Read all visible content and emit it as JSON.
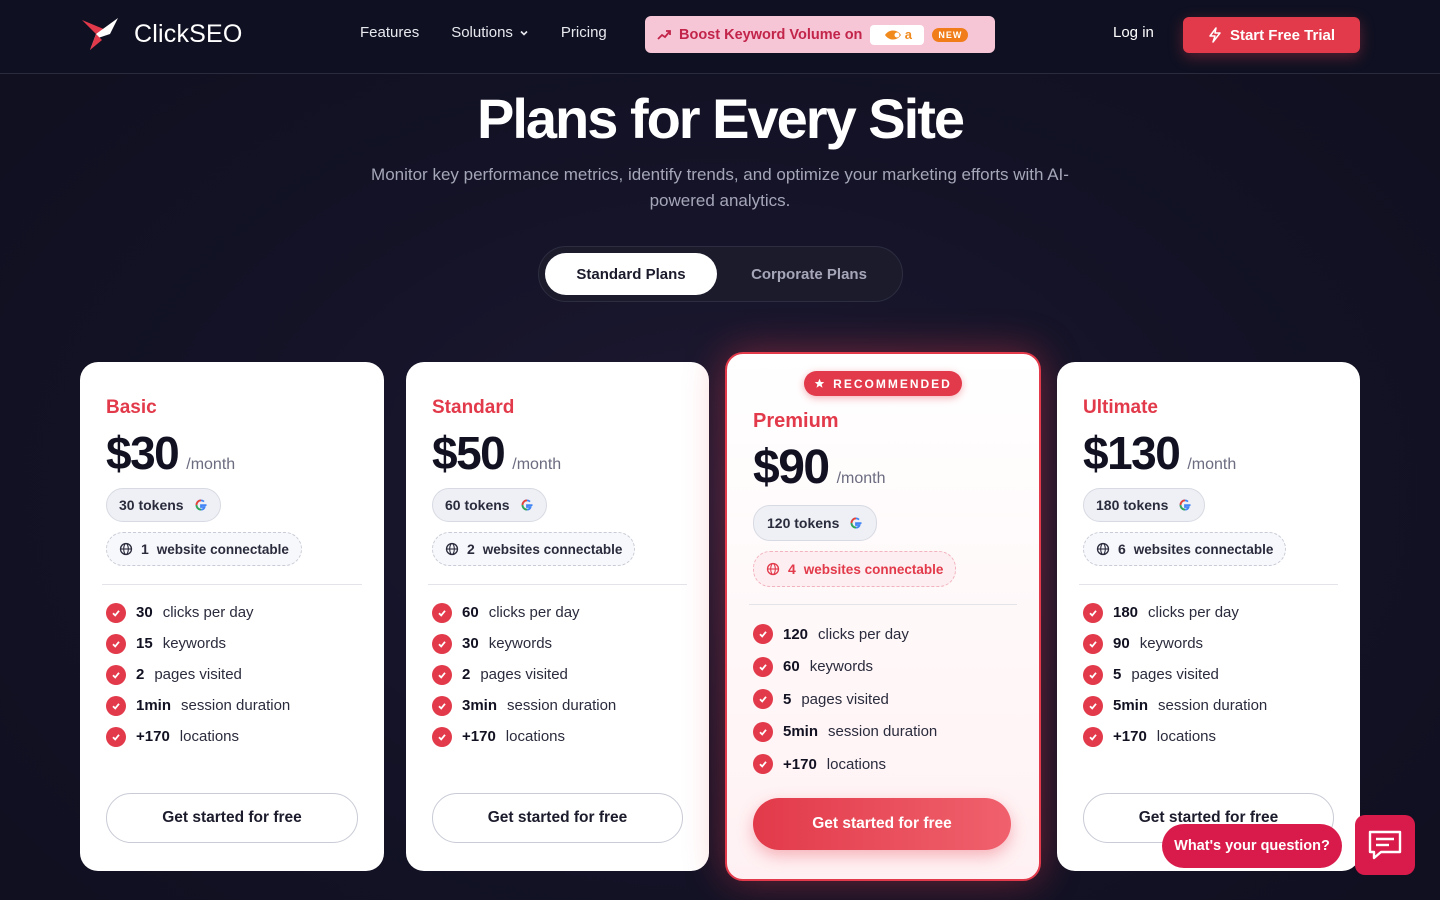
{
  "brand": {
    "name": "ClickSEO",
    "accent": "#e23a4a"
  },
  "nav": {
    "links": [
      {
        "label": "Features"
      },
      {
        "label": "Solutions"
      },
      {
        "label": "Pricing"
      }
    ],
    "promo": {
      "label": "Boost Keyword Volume on",
      "partner_logo": "a",
      "badge": "NEW"
    },
    "login": "Log in",
    "trial": "Start Free Trial"
  },
  "hero": {
    "title": "Plans for Every Site",
    "subtitle": "Monitor key performance metrics, identify trends, and optimize your marketing efforts with AI-powered analytics."
  },
  "toggle": {
    "standard": "Standard Plans",
    "corporate": "Corporate Plans"
  },
  "plans": [
    {
      "name": "Basic",
      "price": "$30",
      "period": "/month",
      "tokens": "30 tokens",
      "websites_num": "1",
      "websites_label": "website connectable",
      "features": [
        {
          "num": "30",
          "label": "clicks per day"
        },
        {
          "num": "15",
          "label": "keywords"
        },
        {
          "num": "2",
          "label": "pages visited"
        },
        {
          "num": "1min",
          "label": "session duration"
        },
        {
          "num": "+170",
          "label": "locations"
        }
      ],
      "cta": "Get started for free"
    },
    {
      "name": "Standard",
      "price": "$50",
      "period": "/month",
      "tokens": "60 tokens",
      "websites_num": "2",
      "websites_label": "websites connectable",
      "features": [
        {
          "num": "60",
          "label": "clicks per day"
        },
        {
          "num": "30",
          "label": "keywords"
        },
        {
          "num": "2",
          "label": "pages visited"
        },
        {
          "num": "3min",
          "label": "session duration"
        },
        {
          "num": "+170",
          "label": "locations"
        }
      ],
      "cta": "Get started for free"
    },
    {
      "name": "Premium",
      "price": "$90",
      "period": "/month",
      "tokens": "120 tokens",
      "websites_num": "4",
      "websites_label": "websites connectable",
      "badge": "RECOMMENDED",
      "features": [
        {
          "num": "120",
          "label": "clicks per day"
        },
        {
          "num": "60",
          "label": "keywords"
        },
        {
          "num": "5",
          "label": "pages visited"
        },
        {
          "num": "5min",
          "label": "session duration"
        },
        {
          "num": "+170",
          "label": "locations"
        }
      ],
      "cta": "Get started for free"
    },
    {
      "name": "Ultimate",
      "price": "$130",
      "period": "/month",
      "tokens": "180 tokens",
      "websites_num": "6",
      "websites_label": "websites connectable",
      "features": [
        {
          "num": "180",
          "label": "clicks per day"
        },
        {
          "num": "90",
          "label": "keywords"
        },
        {
          "num": "5",
          "label": "pages visited"
        },
        {
          "num": "5min",
          "label": "session duration"
        },
        {
          "num": "+170",
          "label": "locations"
        }
      ],
      "cta": "Get started for free"
    }
  ],
  "chat": {
    "prompt": "What's your question?"
  }
}
